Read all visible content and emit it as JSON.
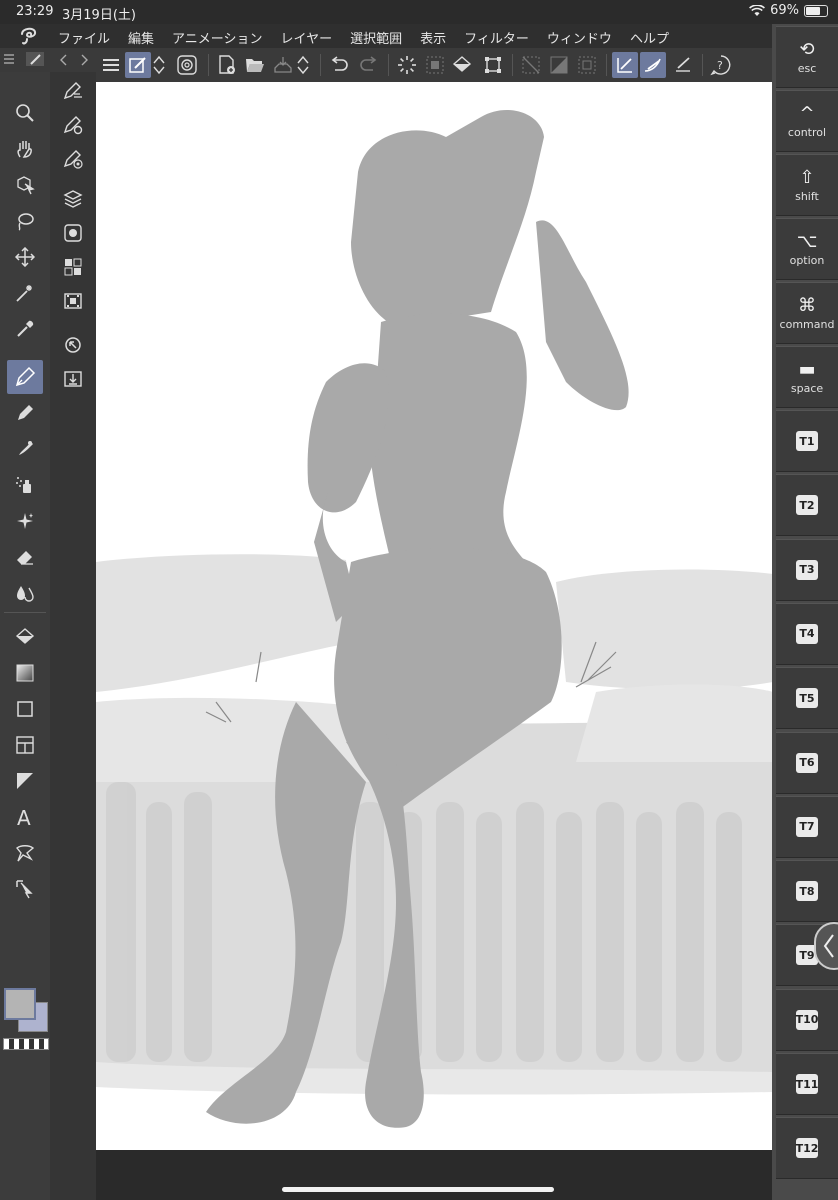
{
  "status": {
    "time": "23:29",
    "date": "3月19日(土)",
    "battery": "69%"
  },
  "menu": [
    "ファイル",
    "編集",
    "アニメーション",
    "レイヤー",
    "選択範囲",
    "表示",
    "フィルター",
    "ウィンドウ",
    "ヘルプ"
  ],
  "tools": [
    "zoom-icon",
    "hand-icon",
    "object-icon",
    "lasso-icon",
    "move-icon",
    "magic-wand-icon",
    "eyedropper-icon",
    "pen-icon",
    "pencil-icon",
    "brush-icon",
    "airbrush-icon",
    "decoration-icon",
    "eraser-icon",
    "blend-icon",
    "fill-icon",
    "gradient-icon",
    "rectangle-icon",
    "frame-icon",
    "ruler-icon",
    "text-icon",
    "balloon-icon",
    "correct-line-icon"
  ],
  "right_keys": [
    {
      "sym": "⟲",
      "label": "esc"
    },
    {
      "sym": "^",
      "label": "control"
    },
    {
      "sym": "⇧",
      "label": "shift"
    },
    {
      "sym": "⌥",
      "label": "option"
    },
    {
      "sym": "⌘",
      "label": "command"
    },
    {
      "sym": "▬",
      "label": "space"
    }
  ],
  "t_keys": [
    "T1",
    "T2",
    "T3",
    "T4",
    "T5",
    "T6",
    "T7",
    "T8",
    "T9",
    "T10",
    "T11",
    "T12"
  ],
  "colors": {
    "main": "#b4b4b4",
    "sub": "#aeb3cf",
    "accent": "#6d7a9e",
    "silhouette": "#a9a9a9"
  }
}
